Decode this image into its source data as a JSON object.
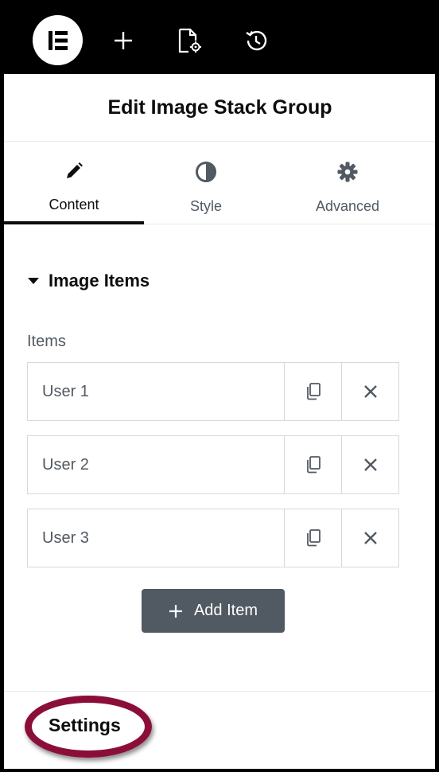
{
  "toolbar": {
    "logo_icon": "elementor-logo-icon",
    "add_icon": "plus-icon",
    "page_settings_icon": "page-settings-icon",
    "history_icon": "history-icon"
  },
  "panel": {
    "title": "Edit Image Stack Group"
  },
  "tabs": [
    {
      "label": "Content",
      "icon": "pencil-icon",
      "active": true
    },
    {
      "label": "Style",
      "icon": "contrast-icon",
      "active": false
    },
    {
      "label": "Advanced",
      "icon": "gear-icon",
      "active": false
    }
  ],
  "section": {
    "title": "Image Items",
    "expanded": true
  },
  "repeater": {
    "label": "Items",
    "items": [
      {
        "title": "User 1"
      },
      {
        "title": "User 2"
      },
      {
        "title": "User 3"
      }
    ],
    "add_label": "Add Item"
  },
  "footer": {
    "settings_label": "Settings"
  },
  "colors": {
    "highlight": "#8b0e3a",
    "add_button": "#515962"
  }
}
